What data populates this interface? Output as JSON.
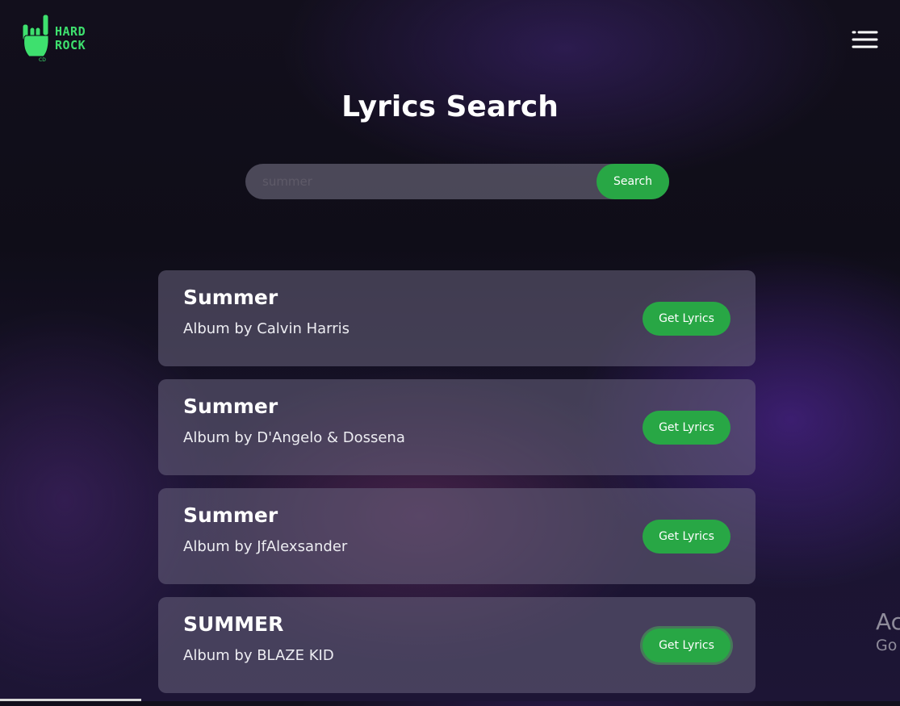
{
  "brand": {
    "logo_line1": "HARD",
    "logo_line2": "ROCK",
    "accent_color": "#3ee06e"
  },
  "header": {
    "menu_icon": "hamburger-icon"
  },
  "page": {
    "title": "Lyrics Search"
  },
  "search": {
    "placeholder": "summer",
    "value": "",
    "button_label": "Search"
  },
  "results": [
    {
      "title": "Summer",
      "subtitle": "Album by Calvin Harris",
      "button_label": "Get Lyrics"
    },
    {
      "title": "Summer",
      "subtitle": "Album by D'Angelo & Dossena",
      "button_label": "Get Lyrics"
    },
    {
      "title": "Summer",
      "subtitle": "Album by JfAlexsander",
      "button_label": "Get Lyrics"
    },
    {
      "title": "SUMMER",
      "subtitle": "Album by BLAZE KID",
      "button_label": "Get Lyrics"
    }
  ],
  "watermark": {
    "line1": "Ac",
    "line2": "Go"
  },
  "colors": {
    "button_green": "#28a745"
  }
}
